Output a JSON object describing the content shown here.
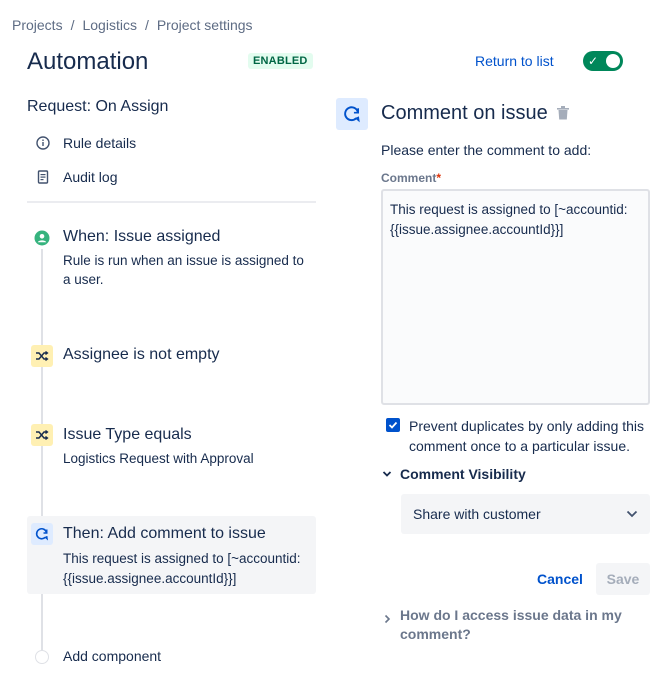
{
  "breadcrumb": [
    "Projects",
    "Logistics",
    "Project settings"
  ],
  "breadcrumb_sep": "/",
  "page_title": "Automation",
  "status_badge": "ENABLED",
  "return_link": "Return to list",
  "toggle": {
    "on": true,
    "color": "#00875a"
  },
  "rule_name": "Request: On Assign",
  "side_links": [
    {
      "label": "Rule details",
      "icon": "info-icon"
    },
    {
      "label": "Audit log",
      "icon": "document-icon"
    }
  ],
  "steps": {
    "trigger": {
      "title": "When: Issue assigned",
      "desc_line1": "Rule is run when an issue is assigned to",
      "desc_line2": "a user.",
      "icon": "user-circle-icon",
      "color": "#36b37e"
    },
    "condition1": {
      "title": "Assignee is not empty",
      "icon": "shuffle-icon",
      "color": "#fff0b3"
    },
    "condition2": {
      "title": "Issue Type equals",
      "desc": "Logistics Request with Approval",
      "icon": "shuffle-icon",
      "color": "#fff0b3"
    },
    "action": {
      "title": "Then: Add comment to issue",
      "desc_line1": "This request is assigned to [~accountid:",
      "desc_line2": "{{issue.assignee.accountId}}]",
      "icon": "comment-refresh-icon",
      "color": "#deebff"
    },
    "add_component": "Add component"
  },
  "panel": {
    "title": "Comment on issue",
    "instruction": "Please enter the comment to add:",
    "field_label": "Comment",
    "required_marker": "*",
    "comment_line1": "This request is assigned to [~accountid:",
    "comment_line2": "{{issue.assignee.accountId}}]",
    "prevent_duplicates_line1": "Prevent duplicates by only adding this",
    "prevent_duplicates_line2": "comment once to a particular issue.",
    "prevent_duplicates_checked": true,
    "visibility_header": "Comment Visibility",
    "visibility_value": "Share with customer",
    "cancel": "Cancel",
    "save": "Save",
    "help_line1": "How do I access issue data in my",
    "help_line2": "comment?"
  },
  "colors": {
    "primary": "#0052cc",
    "text": "#172b4d",
    "muted": "#6b778c",
    "success": "#00875a"
  }
}
